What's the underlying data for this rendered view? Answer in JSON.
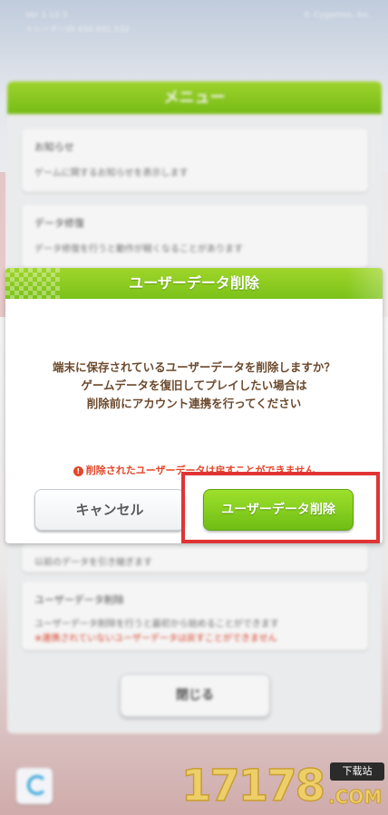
{
  "dialog": {
    "title": "ユーザーデータ削除",
    "message_lines": [
      "端末に保存されているユーザーデータを削除しますか？",
      "ゲームデータを復旧してプレイしたい場合は",
      "削除前にアカウント連携を行ってください"
    ],
    "warning": "削除されたユーザーデータは戻すことができません",
    "cancel_label": "キャンセル",
    "delete_label": "ユーザーデータ削除"
  },
  "background": {
    "status_line1": "Ver 1.12.3",
    "status_line2": "トレーナーID 434 661 532",
    "status_right": "© Cygames, Inc.",
    "menu_title": "メニュー",
    "cards": [
      {
        "title": "お知らせ",
        "desc": "ゲームに関するお知らせを表示します"
      },
      {
        "title": "データ修復",
        "desc": "データ修復を行うと動作が軽くなることがあります"
      },
      {
        "title": "",
        "desc": "以前のデータを引き継ぎます"
      },
      {
        "title": "ユーザーデータ削除",
        "desc": "ユーザーデータ削除を行うと最初から始めることができます",
        "warning": "※連携されていないユーザーデータは戻すことができません"
      }
    ],
    "close_label": "閉じる"
  },
  "watermark": {
    "number": "17178",
    "site": "下载站",
    "domain": ".COM"
  },
  "colors": {
    "accent_green": "#7bc21a",
    "warning_red": "#e4462a",
    "highlight_red": "#e03434"
  }
}
